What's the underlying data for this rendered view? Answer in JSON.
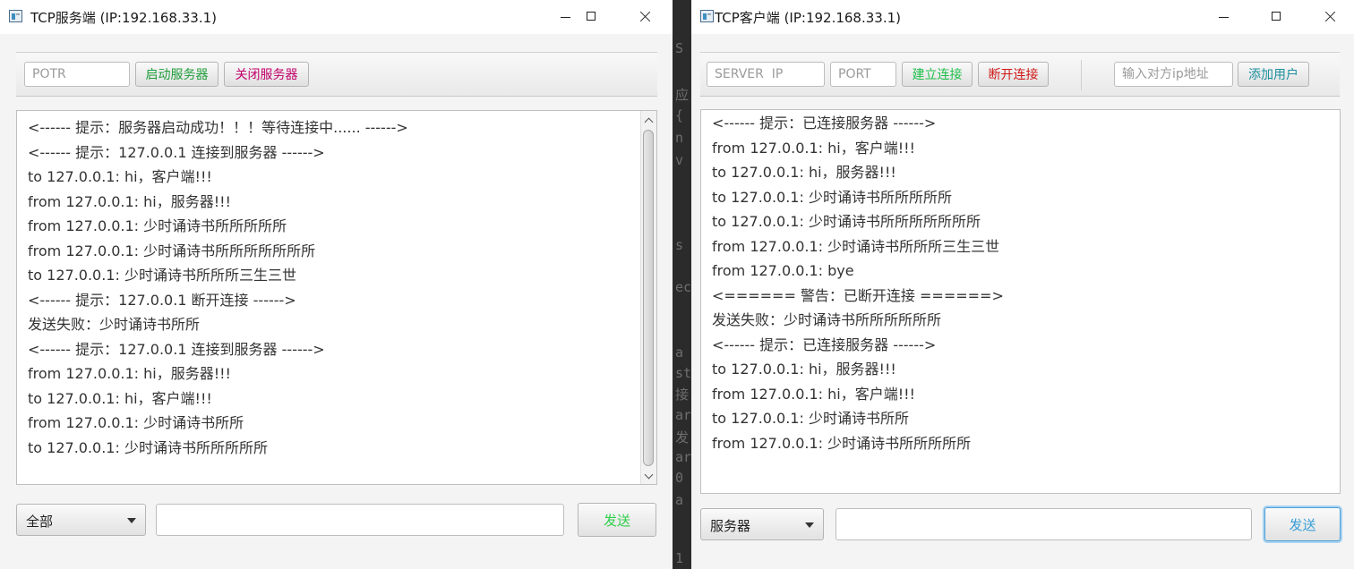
{
  "background_code": {
    "glyphs": [
      "S",
      "应",
      "{",
      "n",
      "v",
      "s",
      "ec",
      "a",
      "st",
      "接",
      "ar",
      "发",
      "ar",
      "0",
      "a",
      "1"
    ]
  },
  "server": {
    "title": "TCP服务端 (IP:192.168.33.1)",
    "port_placeholder": "POTR",
    "start_label": "启动服务器",
    "stop_label": "关闭服务器",
    "log_lines": [
      "<------ 提示：服务器启动成功！！！等待连接中...... ------>",
      "<------ 提示：127.0.0.1 连接到服务器 ------>",
      "to 127.0.0.1: hi，客户端!!!",
      "from 127.0.0.1: hi，服务器!!!",
      "from 127.0.0.1: 少时诵诗书所所所所所",
      "from 127.0.0.1: 少时诵诗书所所所所所所所",
      "to 127.0.0.1: 少时诵诗书所所所三生三世",
      "<------ 提示：127.0.0.1 断开连接 ------>",
      "发送失败：少时诵诗书所所",
      "<------ 提示：127.0.0.1 连接到服务器 ------>",
      "from 127.0.0.1: hi，服务器!!!",
      "to 127.0.0.1: hi，客户端!!!",
      "from 127.0.0.1: 少时诵诗书所所",
      "to 127.0.0.1: 少时诵诗书所所所所所"
    ],
    "target_selected": "全部",
    "message_value": "",
    "send_label": "发送"
  },
  "client": {
    "title": "TCP客户端 (IP:192.168.33.1)",
    "server_ip_placeholder": "SERVER  IP",
    "port_placeholder": "PORT",
    "connect_label": "建立连接",
    "disconnect_label": "断开连接",
    "peer_ip_placeholder": "输入对方ip地址",
    "add_user_label": "添加用户",
    "log_lines": [
      "<------ 提示：已连接服务器 ------>",
      "from 127.0.0.1: hi，客户端!!!",
      "to 127.0.0.1: hi，服务器!!!",
      "to 127.0.0.1: 少时诵诗书所所所所所",
      "to 127.0.0.1: 少时诵诗书所所所所所所所",
      "from 127.0.0.1: 少时诵诗书所所所三生三世",
      "from 127.0.0.1: bye",
      "<====== 警告：已断开连接 ======>",
      "发送失败：少时诵诗书所所所所所所",
      "<------ 提示：已连接服务器 ------>",
      "to 127.0.0.1: hi，服务器!!!",
      "from 127.0.0.1: hi，客户端!!!",
      "to 127.0.0.1: 少时诵诗书所所",
      "from 127.0.0.1: 少时诵诗书所所所所所"
    ],
    "target_selected": "服务器",
    "message_value": "",
    "send_label": "发送"
  },
  "colors": {
    "start_text": "#1f9d3a",
    "stop_text": "#c2006b",
    "connect_text": "#1fbf4a",
    "disconnect_text": "#d01818",
    "add_user_text": "#1c8f9e",
    "send_text": "#2fcf4a",
    "client_send_text": "#3a9fd8"
  }
}
